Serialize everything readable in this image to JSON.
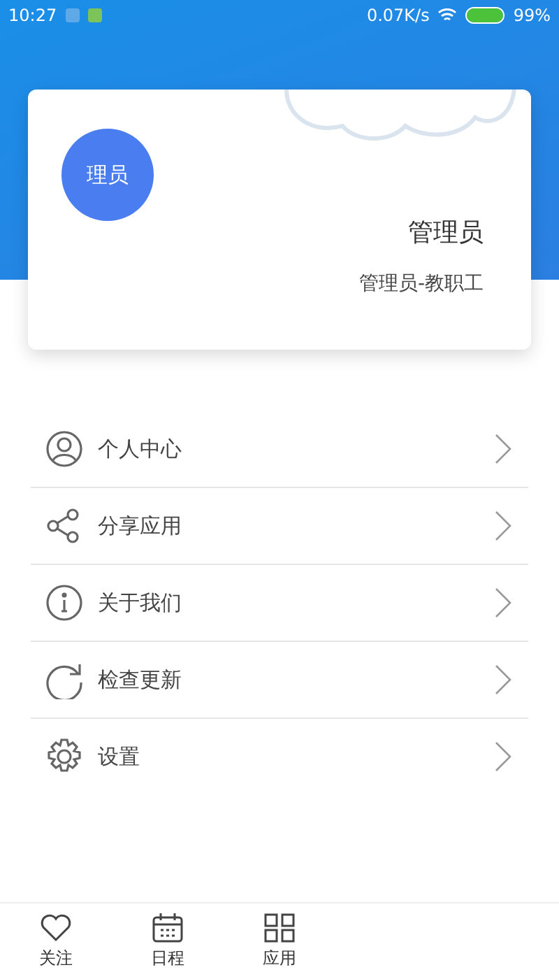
{
  "status_bar": {
    "time": "10:27",
    "speed": "0.07K/s",
    "battery": "99%"
  },
  "profile": {
    "avatar": "理员",
    "name": "管理员",
    "role": "管理员-教职工"
  },
  "menu": [
    {
      "kind": "person",
      "label": "个人中心"
    },
    {
      "kind": "share",
      "label": "分享应用"
    },
    {
      "kind": "info",
      "label": "关于我们"
    },
    {
      "kind": "refresh",
      "label": "检查更新"
    },
    {
      "kind": "gear",
      "label": "设置"
    }
  ],
  "tabs": [
    {
      "kind": "heart",
      "label": "关注"
    },
    {
      "kind": "calendar",
      "label": "日程"
    },
    {
      "kind": "grid",
      "label": "应用"
    }
  ]
}
